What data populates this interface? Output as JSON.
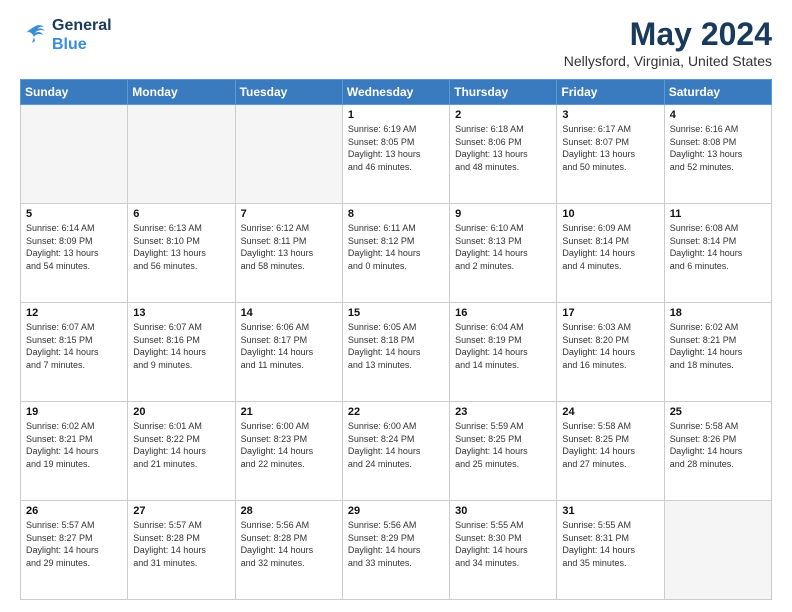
{
  "header": {
    "logo_line1": "General",
    "logo_line2": "Blue",
    "month_year": "May 2024",
    "location": "Nellysford, Virginia, United States"
  },
  "weekdays": [
    "Sunday",
    "Monday",
    "Tuesday",
    "Wednesday",
    "Thursday",
    "Friday",
    "Saturday"
  ],
  "weeks": [
    [
      {
        "day": "",
        "info": ""
      },
      {
        "day": "",
        "info": ""
      },
      {
        "day": "",
        "info": ""
      },
      {
        "day": "1",
        "info": "Sunrise: 6:19 AM\nSunset: 8:05 PM\nDaylight: 13 hours\nand 46 minutes."
      },
      {
        "day": "2",
        "info": "Sunrise: 6:18 AM\nSunset: 8:06 PM\nDaylight: 13 hours\nand 48 minutes."
      },
      {
        "day": "3",
        "info": "Sunrise: 6:17 AM\nSunset: 8:07 PM\nDaylight: 13 hours\nand 50 minutes."
      },
      {
        "day": "4",
        "info": "Sunrise: 6:16 AM\nSunset: 8:08 PM\nDaylight: 13 hours\nand 52 minutes."
      }
    ],
    [
      {
        "day": "5",
        "info": "Sunrise: 6:14 AM\nSunset: 8:09 PM\nDaylight: 13 hours\nand 54 minutes."
      },
      {
        "day": "6",
        "info": "Sunrise: 6:13 AM\nSunset: 8:10 PM\nDaylight: 13 hours\nand 56 minutes."
      },
      {
        "day": "7",
        "info": "Sunrise: 6:12 AM\nSunset: 8:11 PM\nDaylight: 13 hours\nand 58 minutes."
      },
      {
        "day": "8",
        "info": "Sunrise: 6:11 AM\nSunset: 8:12 PM\nDaylight: 14 hours\nand 0 minutes."
      },
      {
        "day": "9",
        "info": "Sunrise: 6:10 AM\nSunset: 8:13 PM\nDaylight: 14 hours\nand 2 minutes."
      },
      {
        "day": "10",
        "info": "Sunrise: 6:09 AM\nSunset: 8:14 PM\nDaylight: 14 hours\nand 4 minutes."
      },
      {
        "day": "11",
        "info": "Sunrise: 6:08 AM\nSunset: 8:14 PM\nDaylight: 14 hours\nand 6 minutes."
      }
    ],
    [
      {
        "day": "12",
        "info": "Sunrise: 6:07 AM\nSunset: 8:15 PM\nDaylight: 14 hours\nand 7 minutes."
      },
      {
        "day": "13",
        "info": "Sunrise: 6:07 AM\nSunset: 8:16 PM\nDaylight: 14 hours\nand 9 minutes."
      },
      {
        "day": "14",
        "info": "Sunrise: 6:06 AM\nSunset: 8:17 PM\nDaylight: 14 hours\nand 11 minutes."
      },
      {
        "day": "15",
        "info": "Sunrise: 6:05 AM\nSunset: 8:18 PM\nDaylight: 14 hours\nand 13 minutes."
      },
      {
        "day": "16",
        "info": "Sunrise: 6:04 AM\nSunset: 8:19 PM\nDaylight: 14 hours\nand 14 minutes."
      },
      {
        "day": "17",
        "info": "Sunrise: 6:03 AM\nSunset: 8:20 PM\nDaylight: 14 hours\nand 16 minutes."
      },
      {
        "day": "18",
        "info": "Sunrise: 6:02 AM\nSunset: 8:21 PM\nDaylight: 14 hours\nand 18 minutes."
      }
    ],
    [
      {
        "day": "19",
        "info": "Sunrise: 6:02 AM\nSunset: 8:21 PM\nDaylight: 14 hours\nand 19 minutes."
      },
      {
        "day": "20",
        "info": "Sunrise: 6:01 AM\nSunset: 8:22 PM\nDaylight: 14 hours\nand 21 minutes."
      },
      {
        "day": "21",
        "info": "Sunrise: 6:00 AM\nSunset: 8:23 PM\nDaylight: 14 hours\nand 22 minutes."
      },
      {
        "day": "22",
        "info": "Sunrise: 6:00 AM\nSunset: 8:24 PM\nDaylight: 14 hours\nand 24 minutes."
      },
      {
        "day": "23",
        "info": "Sunrise: 5:59 AM\nSunset: 8:25 PM\nDaylight: 14 hours\nand 25 minutes."
      },
      {
        "day": "24",
        "info": "Sunrise: 5:58 AM\nSunset: 8:25 PM\nDaylight: 14 hours\nand 27 minutes."
      },
      {
        "day": "25",
        "info": "Sunrise: 5:58 AM\nSunset: 8:26 PM\nDaylight: 14 hours\nand 28 minutes."
      }
    ],
    [
      {
        "day": "26",
        "info": "Sunrise: 5:57 AM\nSunset: 8:27 PM\nDaylight: 14 hours\nand 29 minutes."
      },
      {
        "day": "27",
        "info": "Sunrise: 5:57 AM\nSunset: 8:28 PM\nDaylight: 14 hours\nand 31 minutes."
      },
      {
        "day": "28",
        "info": "Sunrise: 5:56 AM\nSunset: 8:28 PM\nDaylight: 14 hours\nand 32 minutes."
      },
      {
        "day": "29",
        "info": "Sunrise: 5:56 AM\nSunset: 8:29 PM\nDaylight: 14 hours\nand 33 minutes."
      },
      {
        "day": "30",
        "info": "Sunrise: 5:55 AM\nSunset: 8:30 PM\nDaylight: 14 hours\nand 34 minutes."
      },
      {
        "day": "31",
        "info": "Sunrise: 5:55 AM\nSunset: 8:31 PM\nDaylight: 14 hours\nand 35 minutes."
      },
      {
        "day": "",
        "info": ""
      }
    ]
  ]
}
